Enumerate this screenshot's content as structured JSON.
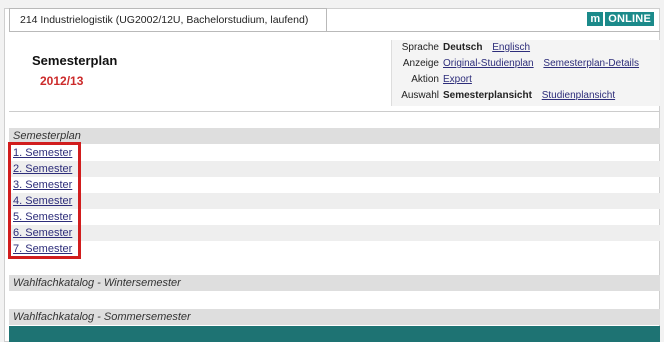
{
  "tab": {
    "label": "214 Industrielogistik (UG2002/12U, Bachelorstudium, laufend)"
  },
  "logo": {
    "mark": "m",
    "word": "ONLINE"
  },
  "header": {
    "title": "Semesterplan",
    "year": "2012/13"
  },
  "info": {
    "sprache": {
      "key": "Sprache",
      "active": "Deutsch",
      "link": "Englisch"
    },
    "anzeige": {
      "key": "Anzeige",
      "link1": "Original-Studienplan",
      "link2": "Semesterplan-Details"
    },
    "aktion": {
      "key": "Aktion",
      "link": "Export"
    },
    "auswahl": {
      "key": "Auswahl",
      "active": "Semesterplansicht",
      "link": "Studienplansicht"
    }
  },
  "sections": {
    "semesterplan": "Semesterplan",
    "winter": "Wahlfachkatalog - Wintersemester",
    "sommer": "Wahlfachkatalog - Sommersemester"
  },
  "semesters": [
    "1. Semester",
    "2. Semester",
    "3. Semester",
    "4. Semester",
    "5. Semester",
    "6. Semester",
    "7. Semester"
  ],
  "colors": {
    "accent": "#1e7373",
    "year": "#cc2a2a",
    "highlight": "#d11d1d"
  }
}
